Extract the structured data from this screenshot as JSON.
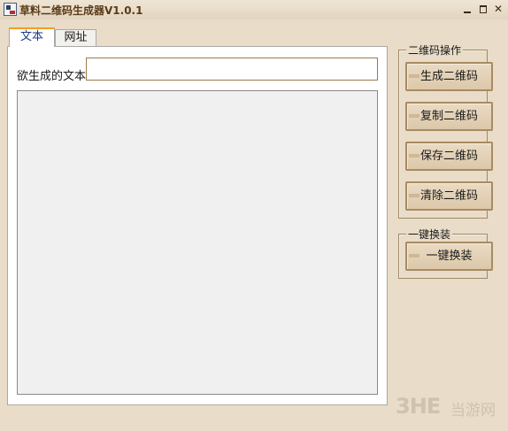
{
  "window": {
    "title": "草料二维码生成器V1.0.1",
    "min_glyph": "",
    "max_glyph": "",
    "close_glyph": "✕"
  },
  "tabs": [
    {
      "label": "文本",
      "selected": true
    },
    {
      "label": "网址",
      "selected": false
    }
  ],
  "text_tab": {
    "input_label": "欲生成的文本:",
    "input_value": ""
  },
  "ops_group": {
    "title": "二维码操作",
    "buttons": [
      "生成二维码",
      "复制二维码",
      "保存二维码",
      "清除二维码"
    ]
  },
  "oneclick_group": {
    "title": "一键换装",
    "button": "一键换装"
  },
  "watermark": {
    "logo": "3HE",
    "text": "当游网"
  },
  "colors": {
    "background": "#e9dcc8",
    "button": "#dcc8aa",
    "tab_accent": "#f0a020",
    "title_text": "#5a3a18"
  }
}
